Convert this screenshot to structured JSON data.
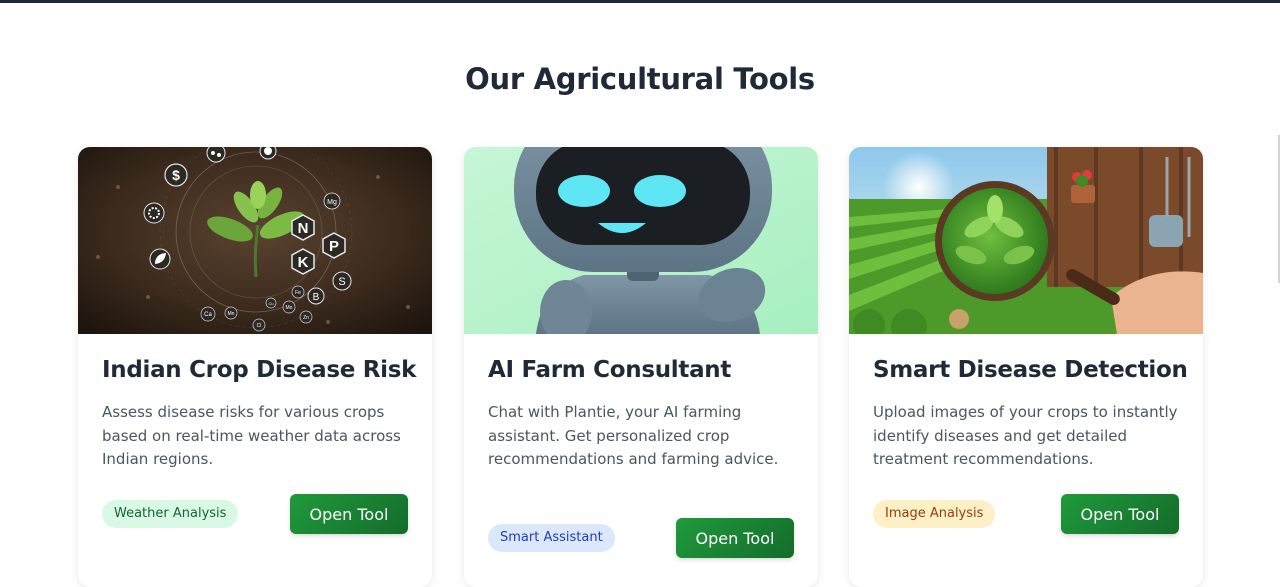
{
  "section": {
    "title": "Our Agricultural Tools"
  },
  "cards": [
    {
      "title": "Indian Crop Disease Risk",
      "description": "Assess disease risks for various crops based on real-time weather data across Indian regions.",
      "tag": "Weather Analysis",
      "button": "Open Tool",
      "image_labels": {
        "n": "N",
        "p": "P",
        "k": "K",
        "s": "S",
        "b": "B",
        "mg": "Mg",
        "fe": "Fe",
        "ca": "Ca",
        "cl": "Cl",
        "mn": "Mn",
        "cu": "Cu",
        "zn": "Zn",
        "mo": "Mo",
        "dollar": "$"
      }
    },
    {
      "title": "AI Farm Consultant",
      "description": "Chat with Plantie, your AI farming assistant. Get personalized crop recommendations and farming advice.",
      "tag": "Smart Assistant",
      "button": "Open Tool"
    },
    {
      "title": "Smart Disease Detection",
      "description": "Upload images of your crops to instantly identify diseases and get detailed treatment recommendations.",
      "tag": "Image Analysis",
      "button": "Open Tool"
    }
  ],
  "colors": {
    "button_green": "#1a8a36",
    "tag_green_bg": "#d9f8e6",
    "tag_blue_bg": "#dbe7fb",
    "tag_amber_bg": "#fdf0c6"
  }
}
